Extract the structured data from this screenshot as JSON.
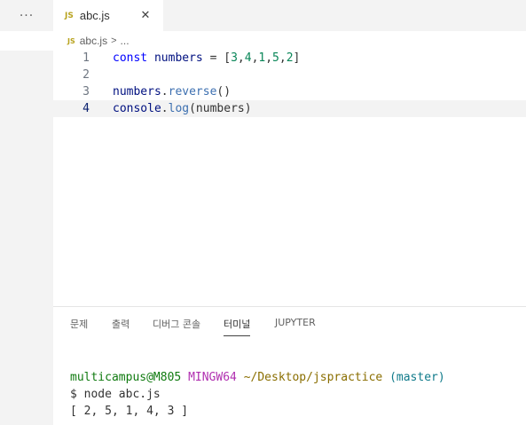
{
  "sidebar": {
    "more_label": "···"
  },
  "tab": {
    "icon_label": "JS",
    "filename": "abc.js",
    "close_label": "✕"
  },
  "breadcrumb": {
    "icon_label": "JS",
    "file": "abc.js",
    "separator": ">",
    "more": "..."
  },
  "editor": {
    "active_line": 4,
    "lines": [
      {
        "number": "1",
        "tokens": [
          {
            "text": "const",
            "kind": "keyword"
          },
          {
            "text": " ",
            "kind": "plain"
          },
          {
            "text": "numbers",
            "kind": "variable"
          },
          {
            "text": " = [",
            "kind": "plain"
          },
          {
            "text": "3",
            "kind": "number"
          },
          {
            "text": ",",
            "kind": "plain"
          },
          {
            "text": "4",
            "kind": "number"
          },
          {
            "text": ",",
            "kind": "plain"
          },
          {
            "text": "1",
            "kind": "number"
          },
          {
            "text": ",",
            "kind": "plain"
          },
          {
            "text": "5",
            "kind": "number"
          },
          {
            "text": ",",
            "kind": "plain"
          },
          {
            "text": "2",
            "kind": "number"
          },
          {
            "text": "]",
            "kind": "plain"
          }
        ]
      },
      {
        "number": "2",
        "tokens": []
      },
      {
        "number": "3",
        "tokens": [
          {
            "text": "numbers",
            "kind": "variable"
          },
          {
            "text": ".",
            "kind": "plain"
          },
          {
            "text": "reverse",
            "kind": "method"
          },
          {
            "text": "()",
            "kind": "plain"
          }
        ]
      },
      {
        "number": "4",
        "tokens": [
          {
            "text": "console",
            "kind": "variable"
          },
          {
            "text": ".",
            "kind": "plain"
          },
          {
            "text": "log",
            "kind": "method"
          },
          {
            "text": "(numbers)",
            "kind": "plain"
          }
        ]
      }
    ]
  },
  "panel": {
    "tabs": [
      {
        "label": "문제",
        "active": false
      },
      {
        "label": "출력",
        "active": false
      },
      {
        "label": "디버그 콘솔",
        "active": false
      },
      {
        "label": "터미널",
        "active": true
      },
      {
        "label": "JUPYTER",
        "active": false
      }
    ]
  },
  "terminal": {
    "prompt_user": "multicampus@M805",
    "prompt_system": "MINGW64",
    "prompt_path": "~/Desktop/jspractice",
    "prompt_branch": "(master)",
    "command": "$ node abc.js",
    "output": "[ 2, 5, 1, 4, 3 ]"
  },
  "colors": {
    "keyword": "#0000ff",
    "variable": "#001080",
    "number": "#098658",
    "method": "#3c6fb0",
    "js_badge": "#b8a31f"
  }
}
